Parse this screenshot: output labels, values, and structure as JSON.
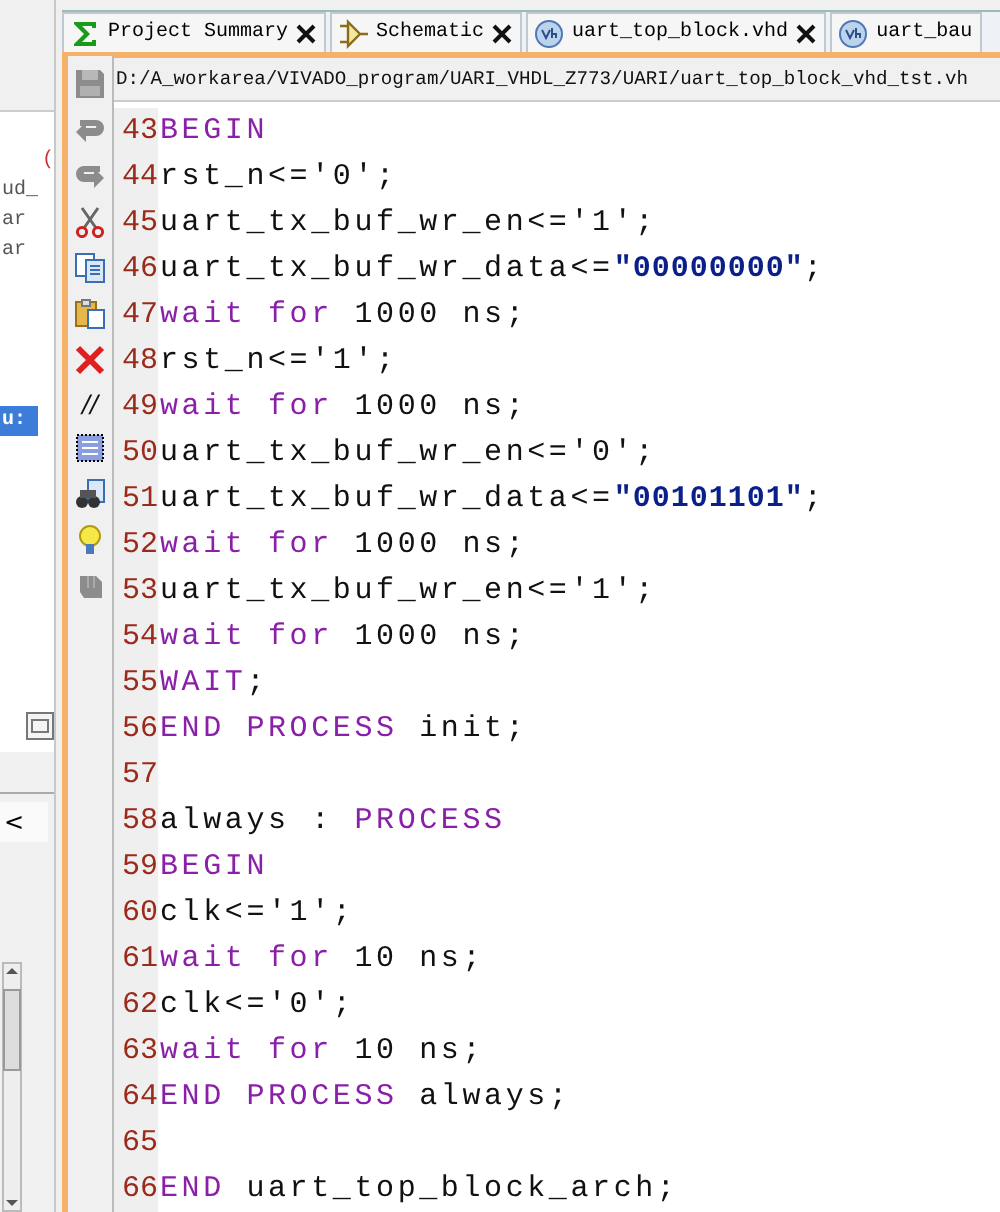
{
  "side_panel": {
    "fragments": [
      "(",
      "ud_",
      "ar",
      "ar"
    ],
    "selected_fragment": "u:",
    "lower_tab_glyph": "<"
  },
  "tabs": [
    {
      "label": "Project Summary",
      "kind": "summary",
      "closable": true,
      "selected": false
    },
    {
      "label": "Schematic",
      "kind": "schematic",
      "closable": true,
      "selected": false
    },
    {
      "label": "uart_top_block.vhd",
      "kind": "source",
      "closable": true,
      "selected": false
    },
    {
      "label": "uart_bau",
      "kind": "source",
      "closable": false,
      "selected": false
    }
  ],
  "path": "D:/A_workarea/VIVADO_program/UARI_VHDL_Z773/UARI/uart_top_block_vhd_tst.vh",
  "toolbar": {
    "comment_glyph": "//"
  },
  "lines": [
    {
      "number": "43",
      "tokens": [
        {
          "kind": "keyword",
          "text": "BEGIN"
        }
      ]
    },
    {
      "number": "44",
      "tokens": [
        {
          "kind": "plain",
          "text": "rst_n<='0';"
        }
      ]
    },
    {
      "number": "45",
      "tokens": [
        {
          "kind": "plain",
          "text": "uart_tx_buf_wr_en<='1';"
        }
      ]
    },
    {
      "number": "46",
      "tokens": [
        {
          "kind": "plain",
          "text": "uart_tx_buf_wr_data<="
        },
        {
          "kind": "string",
          "text": "\"00000000\""
        },
        {
          "kind": "plain",
          "text": ";"
        }
      ]
    },
    {
      "number": "47",
      "tokens": [
        {
          "kind": "keyword",
          "text": "wait for"
        },
        {
          "kind": "plain",
          "text": " 1000 ns;"
        }
      ]
    },
    {
      "number": "48",
      "tokens": [
        {
          "kind": "plain",
          "text": "rst_n<='1';"
        }
      ]
    },
    {
      "number": "49",
      "tokens": [
        {
          "kind": "keyword",
          "text": "wait for"
        },
        {
          "kind": "plain",
          "text": " 1000 ns;"
        }
      ]
    },
    {
      "number": "50",
      "tokens": [
        {
          "kind": "plain",
          "text": "uart_tx_buf_wr_en<='0';"
        }
      ]
    },
    {
      "number": "51",
      "tokens": [
        {
          "kind": "plain",
          "text": "uart_tx_buf_wr_data<="
        },
        {
          "kind": "string",
          "text": "\"00101101\""
        },
        {
          "kind": "plain",
          "text": ";"
        }
      ]
    },
    {
      "number": "52",
      "tokens": [
        {
          "kind": "keyword",
          "text": "wait for"
        },
        {
          "kind": "plain",
          "text": " 1000 ns;"
        }
      ]
    },
    {
      "number": "53",
      "tokens": [
        {
          "kind": "plain",
          "text": "uart_tx_buf_wr_en<='1';"
        }
      ]
    },
    {
      "number": "54",
      "tokens": [
        {
          "kind": "keyword",
          "text": "wait for"
        },
        {
          "kind": "plain",
          "text": " 1000 ns;"
        }
      ]
    },
    {
      "number": "55",
      "tokens": [
        {
          "kind": "keyword",
          "text": "WAIT"
        },
        {
          "kind": "plain",
          "text": ";"
        }
      ]
    },
    {
      "number": "56",
      "tokens": [
        {
          "kind": "keyword",
          "text": "END PROCESS"
        },
        {
          "kind": "plain",
          "text": " init;"
        }
      ]
    },
    {
      "number": "57"
    },
    {
      "number": "58",
      "tokens": [
        {
          "kind": "plain",
          "text": "always : "
        },
        {
          "kind": "keyword",
          "text": "PROCESS"
        }
      ]
    },
    {
      "number": "59",
      "tokens": [
        {
          "kind": "keyword",
          "text": "BEGIN"
        }
      ]
    },
    {
      "number": "60",
      "tokens": [
        {
          "kind": "plain",
          "text": "clk<='1';"
        }
      ]
    },
    {
      "number": "61",
      "tokens": [
        {
          "kind": "keyword",
          "text": "wait for"
        },
        {
          "kind": "plain",
          "text": " 10 ns;"
        }
      ]
    },
    {
      "number": "62",
      "tokens": [
        {
          "kind": "plain",
          "text": "clk<='0';"
        }
      ]
    },
    {
      "number": "63",
      "tokens": [
        {
          "kind": "keyword",
          "text": "wait for"
        },
        {
          "kind": "plain",
          "text": " 10 ns;"
        }
      ]
    },
    {
      "number": "64",
      "tokens": [
        {
          "kind": "keyword",
          "text": "END PROCESS"
        },
        {
          "kind": "plain",
          "text": " always;"
        }
      ]
    },
    {
      "number": "65"
    },
    {
      "number": "66",
      "tokens": [
        {
          "kind": "keyword",
          "text": "END"
        },
        {
          "kind": "plain",
          "text": " uart_top_block_arch;"
        }
      ]
    }
  ]
}
